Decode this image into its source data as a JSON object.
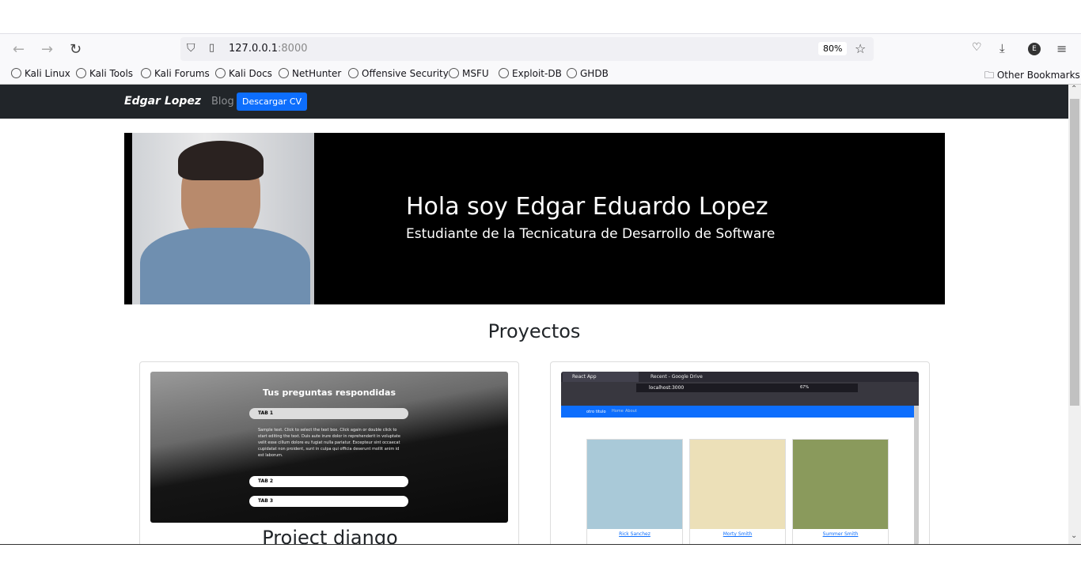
{
  "browser": {
    "url_host": "127.0.0.1",
    "url_port": ":8000",
    "zoom": "80%",
    "bookmarks": [
      "Kali Linux",
      "Kali Tools",
      "Kali Forums",
      "Kali Docs",
      "NetHunter",
      "Offensive Security",
      "MSFU",
      "Exploit-DB",
      "GHDB"
    ],
    "other_bookmarks": "Other Bookmarks",
    "profile_initial": "E"
  },
  "navbar": {
    "brand": "Edgar Lopez",
    "blog": "Blog",
    "cv_button": "Descargar CV"
  },
  "hero": {
    "title": "Hola soy Edgar Eduardo Lopez",
    "subtitle": "Estudiante de la Tecnicatura de Desarrollo de Software"
  },
  "projects": {
    "heading": "Proyectos",
    "items": [
      {
        "title": "Project django",
        "shot": {
          "heading": "Tus preguntas respondidas",
          "tabs": [
            "TAB 1",
            "TAB 2",
            "TAB 3"
          ],
          "text": "Sample text. Click to select the text box. Click again or double click to start editing the text. Duis aute irure dolor in reprehenderit in voluptate velit esse cillum dolore eu fugiat nulla pariatur. Excepteur sint occaecat cupidatat non proident, sunt in culpa qui officia deserunt mollit anim id est laborum."
        }
      },
      {
        "shot": {
          "tabs": [
            "React App",
            "Recent - Google Drive"
          ],
          "url": "localhost:3000",
          "zoom": "67%",
          "nav_title": "otro titulo",
          "nav_links": [
            "Home",
            "About"
          ],
          "characters": [
            "Rick Sanchez",
            "Morty Smith",
            "Summer Smith"
          ]
        }
      }
    ]
  }
}
